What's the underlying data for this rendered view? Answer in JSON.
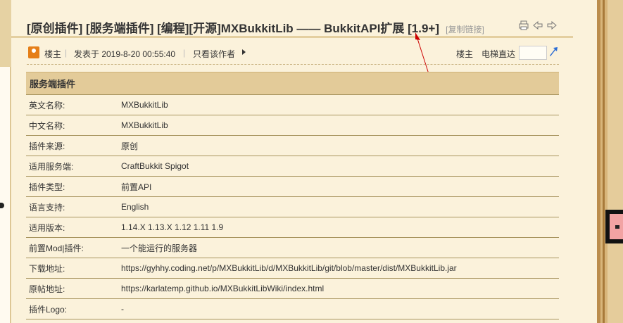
{
  "post": {
    "title": "[原创插件] [服务端插件] [编程][开源]MXBukkitLib —— BukkitAPI扩展 [1.9+]",
    "copy_link": "[复制链接]"
  },
  "author_bar": {
    "floor_label": "楼主",
    "posted_at": "发表于 2019-8-20 00:55:40",
    "only_author": "只看该作者",
    "floor_right": "楼主",
    "jump_label": "电梯直达",
    "jump_value": ""
  },
  "table": {
    "header": "服务端插件",
    "rows": [
      {
        "key": "英文名称:",
        "value": "MXBukkitLib"
      },
      {
        "key": "中文名称:",
        "value": "MXBukkitLib"
      },
      {
        "key": "插件来源:",
        "value": "原创"
      },
      {
        "key": "适用服务端:",
        "value": "CraftBukkit Spigot"
      },
      {
        "key": "插件类型:",
        "value": "前置API"
      },
      {
        "key": "语言支持:",
        "value": "English"
      },
      {
        "key": "适用版本:",
        "value": "1.14.X 1.13.X 1.12 1.11 1.9"
      },
      {
        "key": "前置Mod|插件:",
        "value": "一个能运行的服务器"
      },
      {
        "key": "下载地址:",
        "value": "https://gyhhy.coding.net/p/MXBukkitLib/d/MXBukkitLib/git/blob/master/dist/MXBukkitLib.jar"
      },
      {
        "key": "原帖地址:",
        "value": "https://karlatemp.github.io/MXBukkitLibWiki/index.html"
      },
      {
        "key": "插件Logo:",
        "value": "-"
      }
    ]
  },
  "icons": {
    "print": "printer-icon",
    "prev": "prev-thread-icon",
    "next": "next-thread-icon",
    "author": "author-avatar-icon",
    "jump": "jump-go-icon"
  },
  "colors": {
    "page_bg": "#fbf2db",
    "table_header_bg": "#e3cb99",
    "row_border": "#a8955f",
    "annotation_arrow": "#cc0000",
    "jump_icon": "#2b6cd4"
  }
}
